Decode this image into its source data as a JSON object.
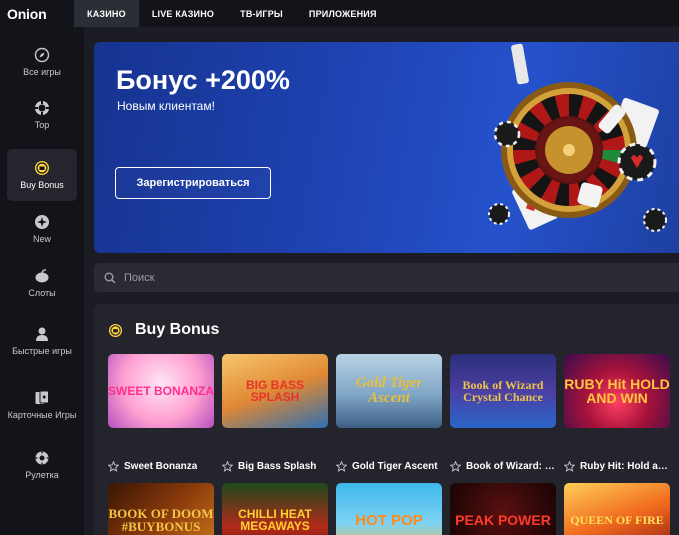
{
  "brand": {
    "logo": "Onion"
  },
  "topnav": [
    "КАЗИНО",
    "LIVE КАЗИНО",
    "ТВ-ИГРЫ",
    "ПРИЛОЖЕНИЯ"
  ],
  "sidebar": [
    {
      "label": "Все игры",
      "icon": "compass-icon"
    },
    {
      "label": "Top",
      "icon": "chip-icon"
    },
    {
      "label": "Buy Bonus",
      "icon": "bonus-coin-icon"
    },
    {
      "label": "New",
      "icon": "sparkle-icon"
    },
    {
      "label": "Слоты",
      "icon": "cherries-icon"
    },
    {
      "label": "Быстрые игры",
      "icon": "person-icon"
    },
    {
      "label": "Карточные Игры",
      "icon": "cards-icon"
    },
    {
      "label": "Рулетка",
      "icon": "roulette-icon"
    }
  ],
  "banner": {
    "title": "Бонус +200%",
    "subtitle": "Новым клиентам!",
    "cta": "Зарегистрироваться"
  },
  "search": {
    "placeholder": "Поиск"
  },
  "section": {
    "title": "Buy Bonus"
  },
  "games": [
    {
      "name": "Sweet Bonanza",
      "tile_text": "SWEET BONANZA"
    },
    {
      "name": "Big Bass Splash",
      "tile_text": "BIG BASS SPLASH"
    },
    {
      "name": "Gold Tiger Ascent",
      "tile_text": "Gold Tiger Ascent"
    },
    {
      "name": "Book of Wizard: Crystal Chance",
      "tile_text": "Book of Wizard Crystal Chance"
    },
    {
      "name": "Ruby Hit: Hold and Win",
      "tile_text": "RUBY Hit HOLD AND WIN"
    },
    {
      "name": "",
      "tile_text": "BOOK OF DOOM #BUYBONUS"
    },
    {
      "name": "",
      "tile_text": "CHILLI HEAT MEGAWAYS"
    },
    {
      "name": "",
      "tile_text": "HOT POP"
    },
    {
      "name": "",
      "tile_text": "PEAK POWER"
    },
    {
      "name": "",
      "tile_text": "QUEEN OF FIRE"
    }
  ],
  "colors": {
    "accent": "#ffd23f",
    "banner": "#1f44b5",
    "panel": "#23242c"
  }
}
